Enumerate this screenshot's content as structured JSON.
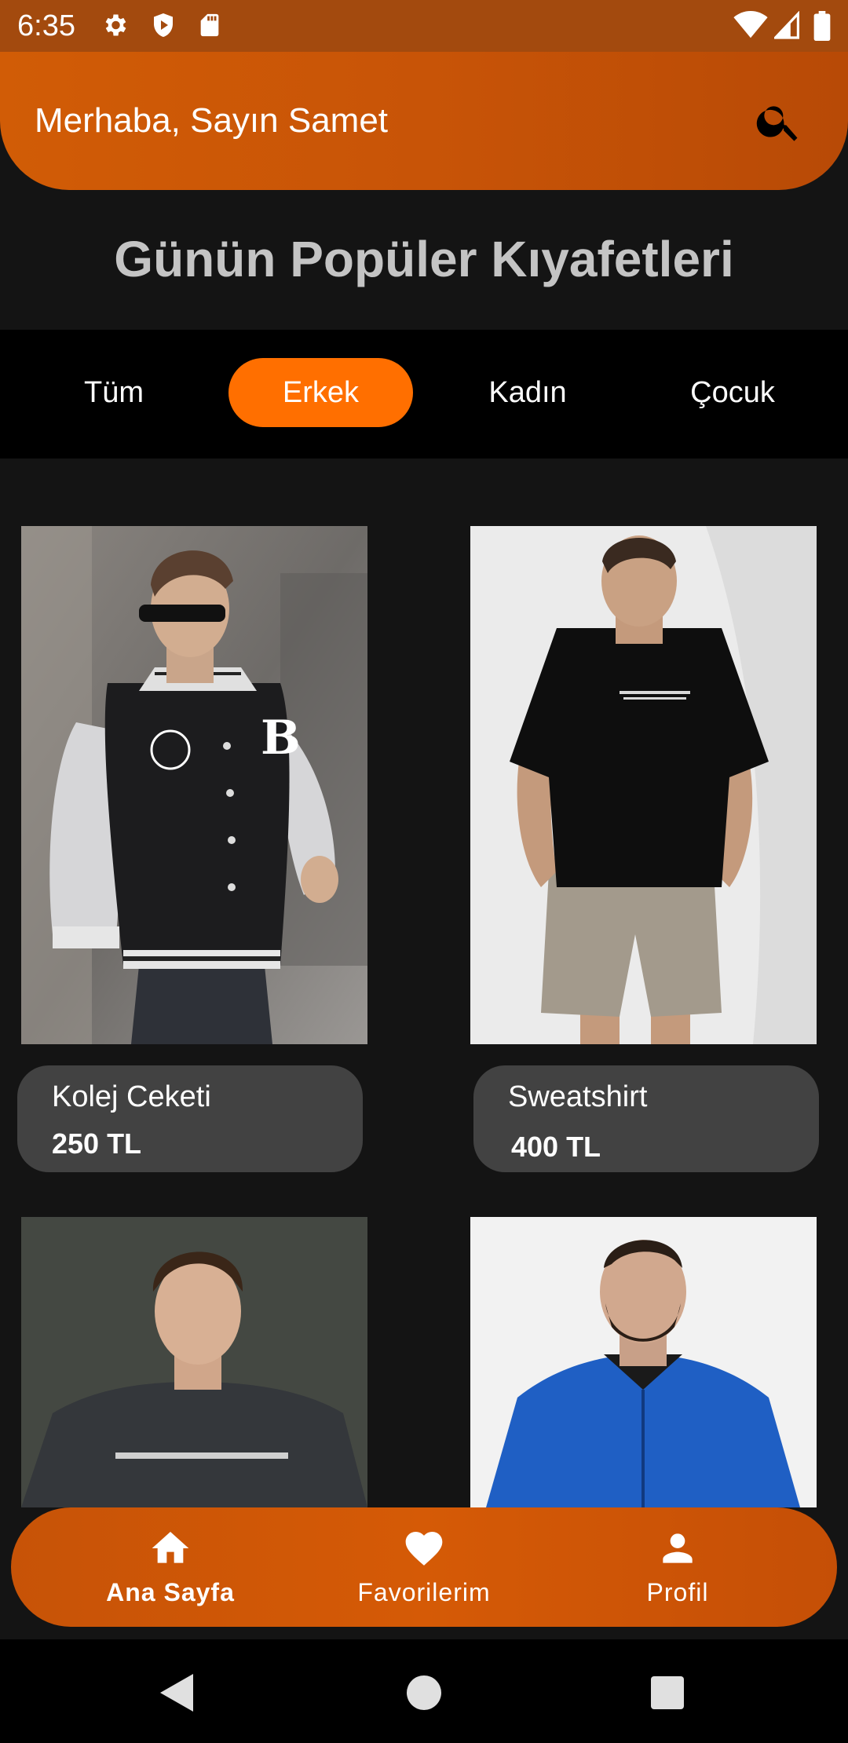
{
  "status_bar": {
    "time": "6:35",
    "left_icons": [
      "gear-icon",
      "shield-play-icon",
      "sd-card-icon"
    ],
    "right_icons": [
      "wifi-icon",
      "cell-signal-icon",
      "battery-icon"
    ]
  },
  "header": {
    "greeting": "Merhaba, Sayın Samet",
    "search_icon": "search-icon"
  },
  "page_title": "Günün Popüler Kıyafetleri",
  "tabs": [
    {
      "label": "Tüm",
      "active": false
    },
    {
      "label": "Erkek",
      "active": true
    },
    {
      "label": "Kadın",
      "active": false
    },
    {
      "label": "Çocuk",
      "active": false
    }
  ],
  "products": [
    {
      "name": "Kolej Ceketi",
      "price": "250 TL"
    },
    {
      "name": "Sweatshirt",
      "price": "400 TL"
    }
  ],
  "bottom_nav": [
    {
      "label": "Ana Sayfa",
      "icon": "home-icon",
      "active": true
    },
    {
      "label": "Favorilerim",
      "icon": "heart-icon",
      "active": false
    },
    {
      "label": "Profil",
      "icon": "person-icon",
      "active": false
    }
  ],
  "colors": {
    "accent": "#ff6f00",
    "header": "#c85407",
    "status_bar": "#a34a0e",
    "background": "#141414",
    "card": "#424242"
  }
}
